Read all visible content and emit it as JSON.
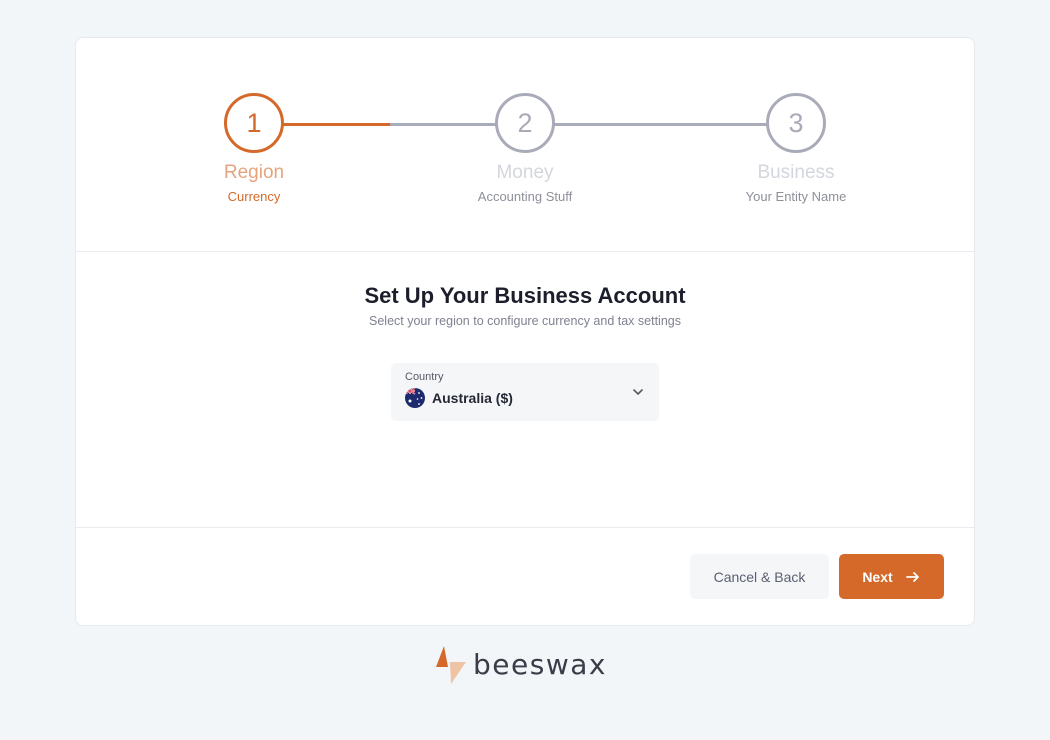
{
  "stepper": {
    "steps": [
      {
        "number": "1",
        "title": "Region",
        "subtitle": "Currency",
        "state": "active"
      },
      {
        "number": "2",
        "title": "Money",
        "subtitle": "Accounting Stuff",
        "state": "pending"
      },
      {
        "number": "3",
        "title": "Business",
        "subtitle": "Your Entity Name",
        "state": "pending"
      }
    ]
  },
  "main": {
    "heading": "Set Up Your Business Account",
    "subheading": "Select your region to configure currency and tax settings",
    "country_select": {
      "label": "Country",
      "value": "Australia ($)",
      "flag_icon": "australia-flag-icon"
    }
  },
  "footer": {
    "cancel_label": "Cancel & Back",
    "next_label": "Next"
  },
  "brand": {
    "name": "beeswax",
    "accent": "#d5692a",
    "pending_color": "#a9abb8"
  }
}
